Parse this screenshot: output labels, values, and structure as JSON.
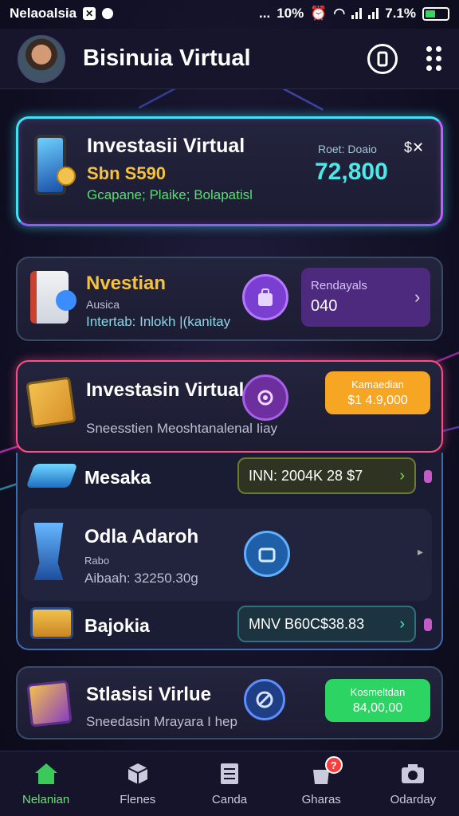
{
  "status_bar": {
    "carrier": "Nelaoalsia",
    "dots": "...",
    "net": "10%",
    "battery": "7.1%"
  },
  "header": {
    "title": "Bisinuia Virtual"
  },
  "hero": {
    "title": "Investasii Virtual",
    "amount": "Sbn S590",
    "tags": "Gcapane; Plaike; Bolapatisl",
    "meta_label": "Roet: Doaio",
    "meta_badge": "$✕",
    "value": "72,800"
  },
  "card2": {
    "title": "Nvestian",
    "sub1": "Ausica",
    "sub2": "Intertab: Inlokh |(kanitay",
    "panel_label": "Rendayals",
    "panel_value": "040"
  },
  "card3": {
    "title": "Investasin Virtual",
    "desc": "Sneesstien Meoshtanalenal Iiay",
    "pill_label": "Kamaedian",
    "pill_value": "$1 4.9,000"
  },
  "list": [
    {
      "title": "Mesaka",
      "pill": "INN: 2004K 28 $7"
    },
    {
      "title": "Odla Adaroh",
      "sub1": "Rabo",
      "sub2": "Aibaah: 32250.30g"
    },
    {
      "title": "Bajokia",
      "pill": "MNV B60C$38.83"
    }
  ],
  "card4": {
    "title": "Stlasisi Virlue",
    "desc": "Sneedasin Mrayara I hep",
    "pill_label": "Kosmeltdan",
    "pill_value": "84,00,00"
  },
  "bottom_nav": [
    {
      "label": "Nelanian",
      "icon": "home-icon"
    },
    {
      "label": "Flenes",
      "icon": "cube-icon"
    },
    {
      "label": "Canda",
      "icon": "list-icon"
    },
    {
      "label": "Gharas",
      "icon": "bag-icon",
      "badge": "?"
    },
    {
      "label": "Odarday",
      "icon": "camera-icon"
    }
  ],
  "colors": {
    "accent_cyan": "#3ee2f5",
    "accent_pink": "#ff4d88",
    "accent_orange": "#f7a623",
    "accent_green": "#2bd463",
    "nav_active": "#6fe07a"
  }
}
